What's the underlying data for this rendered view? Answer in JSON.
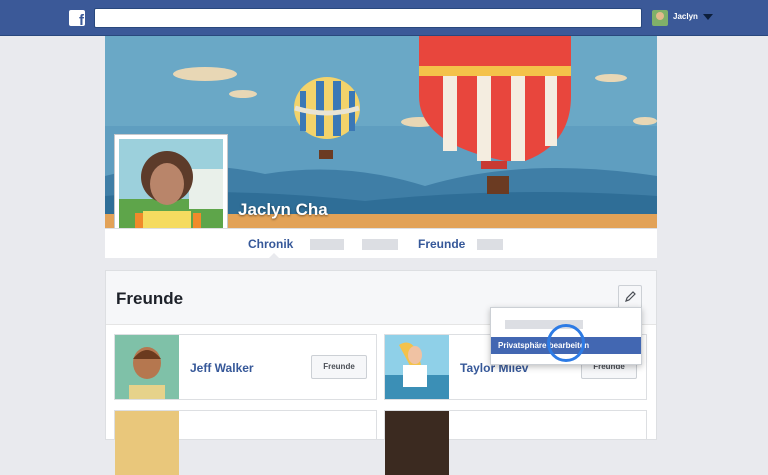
{
  "topbar": {
    "logo_letter": "f",
    "search": {
      "value": "",
      "placeholder": ""
    },
    "user_name": "Jaclyn",
    "color": "#3b5998"
  },
  "profile": {
    "name": "Jaclyn Cha",
    "nav": {
      "timeline": "Chronik",
      "friends": "Freunde"
    }
  },
  "friends_section": {
    "title": "Freunde",
    "edit_icon": "pencil-icon",
    "cards": [
      {
        "name": "Jeff Walker",
        "button": "Freunde"
      },
      {
        "name": "Taylor Miiev",
        "button": "Freunde"
      }
    ]
  },
  "dropdown": {
    "highlighted_item": "Privatsphäre bearbeiten"
  }
}
